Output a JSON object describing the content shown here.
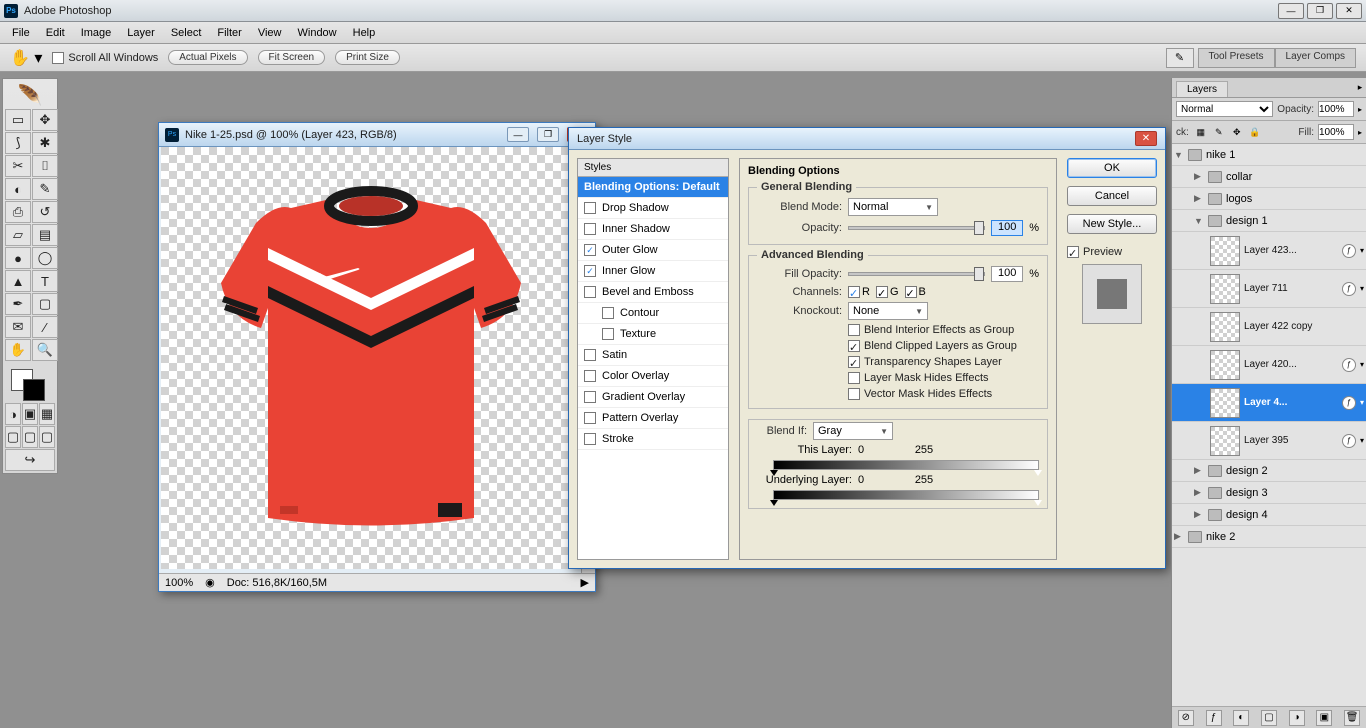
{
  "titlebar": {
    "app_name": "Adobe Photoshop"
  },
  "menubar": [
    "File",
    "Edit",
    "Image",
    "Layer",
    "Select",
    "Filter",
    "View",
    "Window",
    "Help"
  ],
  "optionbar": {
    "scroll_all": "Scroll All Windows",
    "buttons": [
      "Actual Pixels",
      "Fit Screen",
      "Print Size"
    ],
    "presets": [
      "Tool Presets",
      "Layer Comps"
    ]
  },
  "document": {
    "title": "Nike 1-25.psd @ 100% (Layer 423, RGB/8)",
    "zoom": "100%",
    "doc_info": "Doc: 516,8K/160,5M"
  },
  "layer_style": {
    "title": "Layer Style",
    "styles_header": "Styles",
    "selected": "Blending Options: Default",
    "options": [
      {
        "label": "Drop Shadow",
        "checked": false
      },
      {
        "label": "Inner Shadow",
        "checked": false
      },
      {
        "label": "Outer Glow",
        "checked": true
      },
      {
        "label": "Inner Glow",
        "checked": true
      },
      {
        "label": "Bevel and Emboss",
        "checked": false
      },
      {
        "label": "Contour",
        "checked": false,
        "sub": true
      },
      {
        "label": "Texture",
        "checked": false,
        "sub": true
      },
      {
        "label": "Satin",
        "checked": false
      },
      {
        "label": "Color Overlay",
        "checked": false
      },
      {
        "label": "Gradient Overlay",
        "checked": false
      },
      {
        "label": "Pattern Overlay",
        "checked": false
      },
      {
        "label": "Stroke",
        "checked": false
      }
    ],
    "blending": {
      "header": "Blending Options",
      "general": "General Blending",
      "blend_mode_label": "Blend Mode:",
      "blend_mode_value": "Normal",
      "opacity_label": "Opacity:",
      "opacity_value": "100",
      "pct": "%",
      "advanced": "Advanced Blending",
      "fill_opacity_label": "Fill Opacity:",
      "fill_opacity_value": "100",
      "channels_label": "Channels:",
      "chan_r": "R",
      "chan_g": "G",
      "chan_b": "B",
      "knockout_label": "Knockout:",
      "knockout_value": "None",
      "opt1": "Blend Interior Effects as Group",
      "opt2": "Blend Clipped Layers as Group",
      "opt3": "Transparency Shapes Layer",
      "opt4": "Layer Mask Hides Effects",
      "opt5": "Vector Mask Hides Effects",
      "blend_if_label": "Blend If:",
      "blend_if_value": "Gray",
      "this_layer": "This Layer:",
      "underlying": "Underlying Layer:",
      "val0": "0",
      "val255": "255"
    },
    "ok": "OK",
    "cancel": "Cancel",
    "new_style": "New Style...",
    "preview": "Preview"
  },
  "layers_panel": {
    "tab": "Layers",
    "blend_mode": "Normal",
    "opacity_label": "Opacity:",
    "opacity_value": "100%",
    "fill_label": "Fill:",
    "fill_value": "100%",
    "lock_label": "ck:",
    "groups": [
      {
        "type": "group",
        "name": "nike 1",
        "indent": 0,
        "open": true
      },
      {
        "type": "group",
        "name": "collar",
        "indent": 1,
        "open": false
      },
      {
        "type": "group",
        "name": "logos",
        "indent": 1,
        "open": false
      },
      {
        "type": "group",
        "name": "design 1",
        "indent": 1,
        "open": true
      },
      {
        "type": "layer",
        "name": "Layer 423...",
        "indent": 2,
        "fx": true
      },
      {
        "type": "layer",
        "name": "Layer 711",
        "indent": 2,
        "fx": true
      },
      {
        "type": "layer",
        "name": "Layer 422 copy",
        "indent": 2,
        "fx": false
      },
      {
        "type": "layer",
        "name": "Layer 420...",
        "indent": 2,
        "fx": true
      },
      {
        "type": "layer",
        "name": "Layer 4...",
        "indent": 2,
        "fx": true,
        "selected": true,
        "pointer": true
      },
      {
        "type": "layer",
        "name": "Layer 395",
        "indent": 2,
        "fx": true
      },
      {
        "type": "group",
        "name": "design 2",
        "indent": 1,
        "open": false
      },
      {
        "type": "group",
        "name": "design 3",
        "indent": 1,
        "open": false
      },
      {
        "type": "group",
        "name": "design 4",
        "indent": 1,
        "open": false
      },
      {
        "type": "group",
        "name": "nike 2",
        "indent": 0,
        "open": false
      }
    ]
  }
}
